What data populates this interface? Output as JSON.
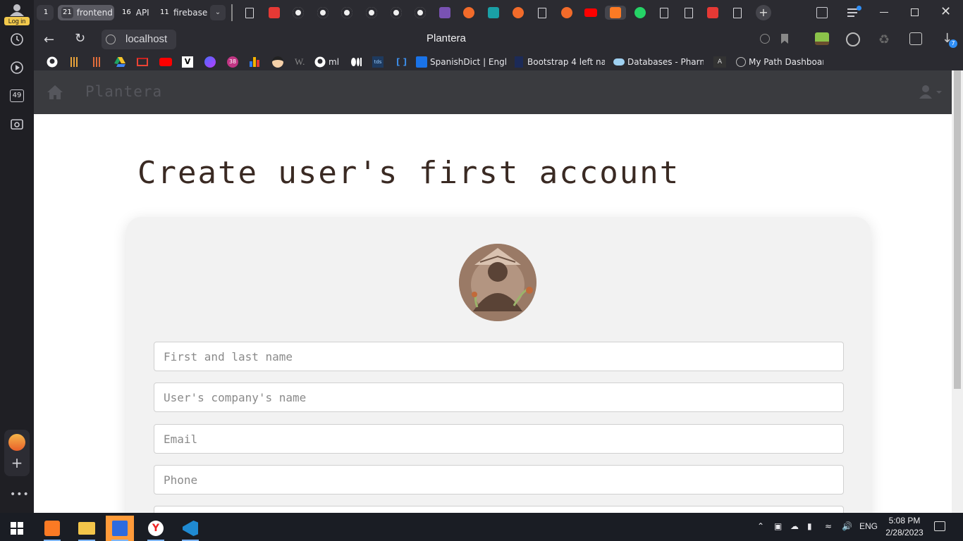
{
  "sidebar": {
    "login_label": "Log in",
    "badge_count": "49"
  },
  "tabs": {
    "groups": [
      {
        "num": "1",
        "label": ""
      },
      {
        "num": "21",
        "label": "frontend"
      },
      {
        "num": "16",
        "label": "API"
      },
      {
        "num": "11",
        "label": "firebase"
      }
    ],
    "icons": [
      "page-icon",
      "pdf-icon",
      "github-icon",
      "github-icon",
      "github-icon",
      "github-icon",
      "github-icon",
      "github-icon",
      "bootstrap-icon",
      "brave-icon",
      "s-icon",
      "brave-icon",
      "page-icon",
      "brave-icon",
      "youtube-icon",
      "xampp-icon",
      "whatsapp-icon",
      "page-icon",
      "page-icon",
      "pdf-icon",
      "page-icon"
    ]
  },
  "address": {
    "url": "localhost",
    "title": "Plantera",
    "downloads_badge": "7"
  },
  "bookmarks": {
    "items": [
      {
        "label": "ml"
      },
      {
        "label": "SpanishDict | Engli"
      },
      {
        "label": "Bootstrap 4 left na"
      },
      {
        "label": "Databases - Pharm"
      },
      {
        "label": "My Path Dashboar"
      }
    ],
    "badge": "38"
  },
  "navbar": {
    "brand": "Plantera"
  },
  "main": {
    "heading": "Create user's first account",
    "fields": {
      "name_placeholder": "First and last name",
      "company_placeholder": "User's company's name",
      "email_placeholder": "Email",
      "phone_placeholder": "Phone"
    }
  },
  "taskbar": {
    "lang": "ENG",
    "time": "5:08 PM",
    "date": "2/28/2023"
  },
  "colors": {
    "heading": "#3a2a23",
    "card": "#f2f2f2",
    "navbar": "#3a3b3f",
    "avatar": "#9a7a66"
  }
}
